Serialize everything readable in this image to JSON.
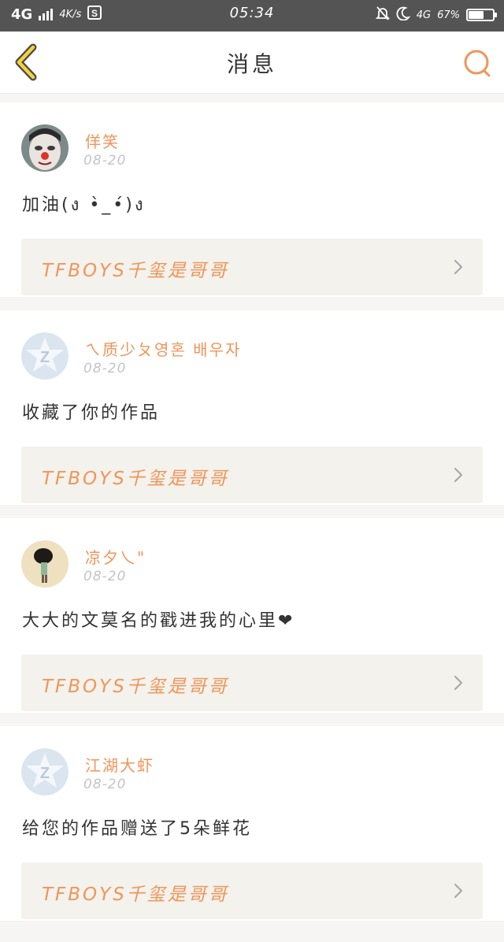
{
  "status_bar": {
    "network": "4G",
    "speed": "4K/s",
    "time": "05:34",
    "network2": "4G",
    "battery_percent": "67%",
    "battery_level": 0.67
  },
  "header": {
    "title": "消息",
    "accent_color": "#f0955a"
  },
  "messages": [
    {
      "name": "佯笑",
      "date": "08-20",
      "content": "加油(ง •̀_•́)ง",
      "link": "TFBOYS千玺是哥哥",
      "avatar": "photo-avatar"
    },
    {
      "name": "ㄟ质少ㄆ영혼 배우자",
      "date": "08-20",
      "content": "收藏了你的作品",
      "link": "TFBOYS千玺是哥哥",
      "avatar": "default-avatar"
    },
    {
      "name": "凉夕乀\"",
      "date": "08-20",
      "content": "大大的文莫名的戳进我的心里❤",
      "link": "TFBOYS千玺是哥哥",
      "avatar": "photo-avatar"
    },
    {
      "name": "江湖大虾",
      "date": "08-20",
      "content": "给您的作品赠送了5朵鲜花",
      "link": "TFBOYS千玺是哥哥",
      "avatar": "default-avatar"
    }
  ]
}
